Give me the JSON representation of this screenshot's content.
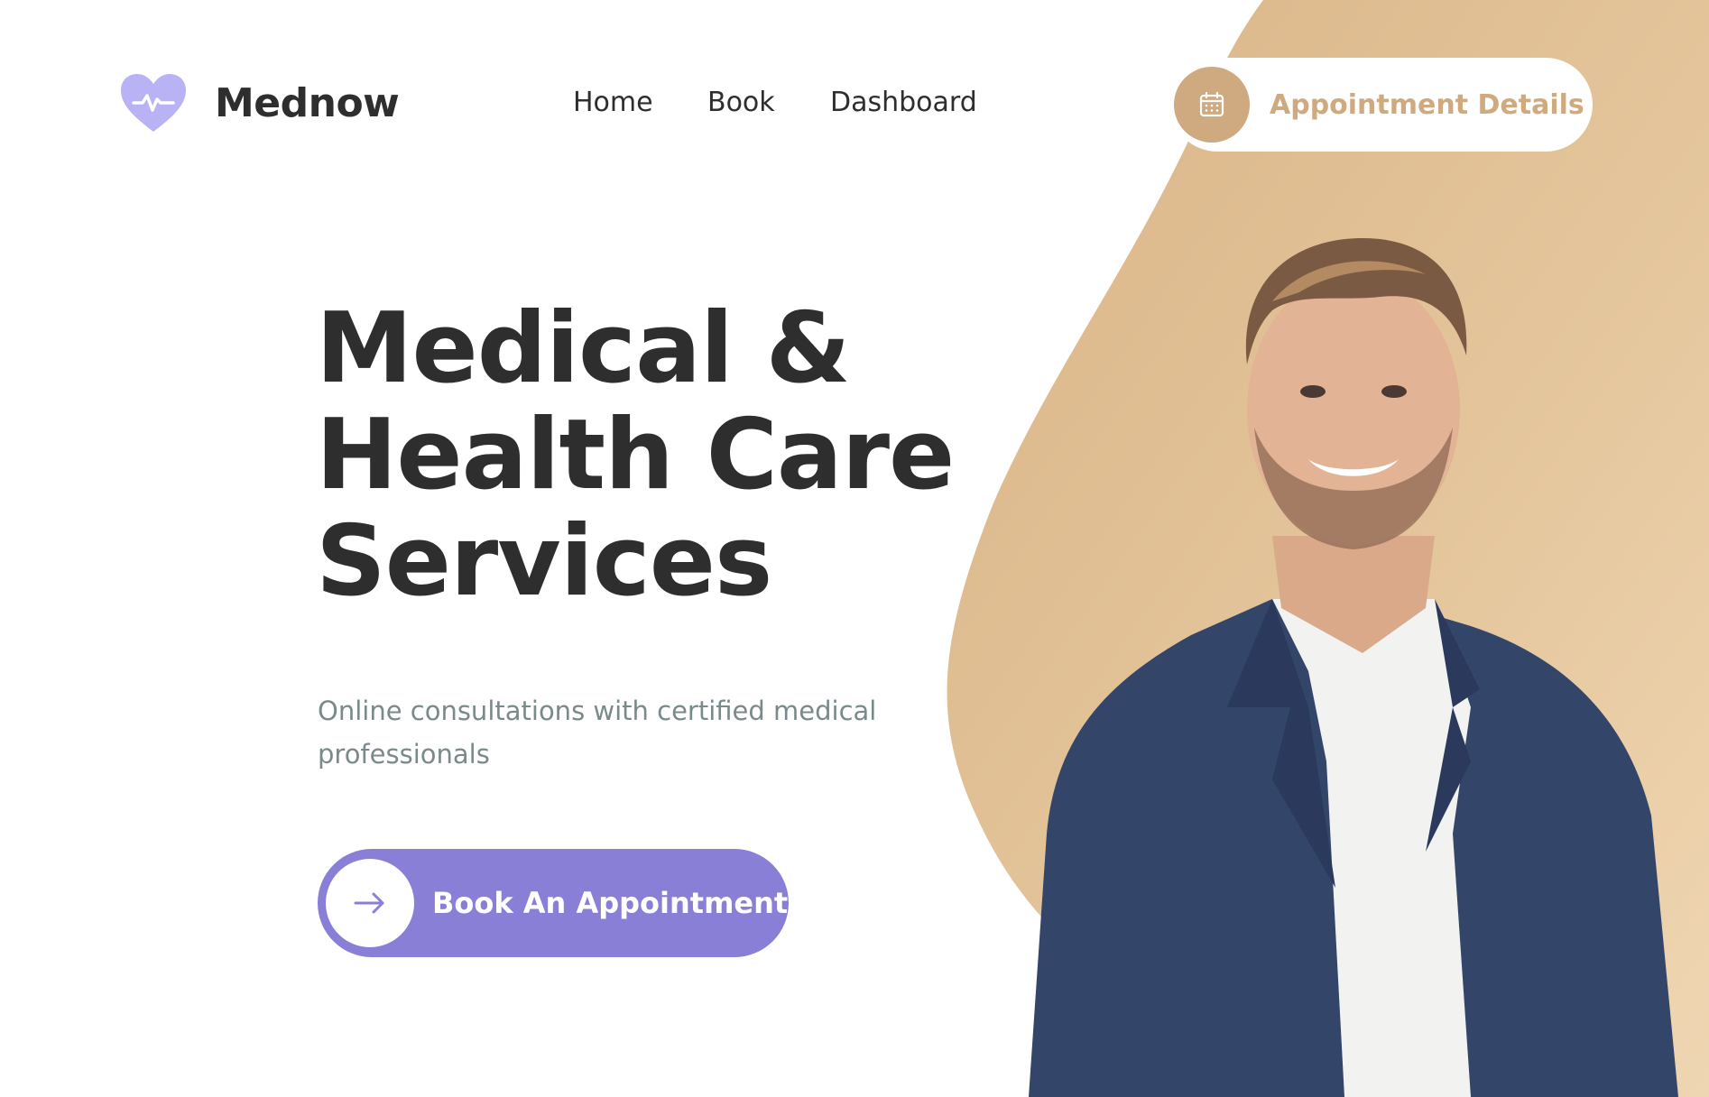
{
  "brand": {
    "name": "Mednow",
    "logo_icon": "heart-pulse-icon",
    "accent": "#8a7fd6",
    "secondary": "#cfa97f"
  },
  "nav": {
    "items": [
      {
        "label": "Home"
      },
      {
        "label": "Book"
      },
      {
        "label": "Dashboard"
      }
    ]
  },
  "header": {
    "appointment_details_label": "Appointment Details",
    "appointment_icon": "calendar-icon"
  },
  "hero": {
    "title_lines": [
      "Medical &",
      "Health Care",
      "Services"
    ],
    "subtitle": "Online consultations with certified medical professionals",
    "cta_label": "Book An Appointment",
    "cta_icon": "arrow-right-icon",
    "image": "smiling-man-in-blazer-photo"
  }
}
